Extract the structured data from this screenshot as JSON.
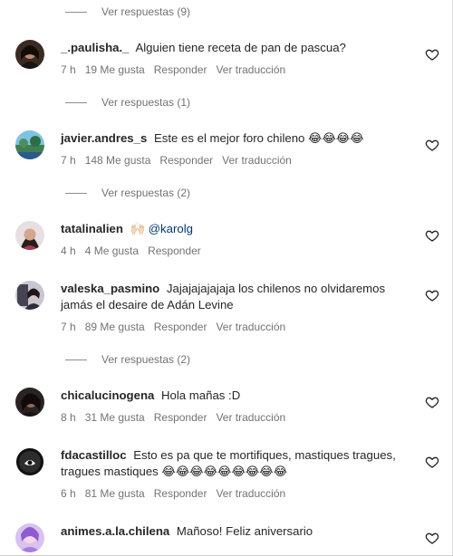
{
  "replies_label": {
    "r1": "Ver respuestas (9)",
    "r2": "Ver respuestas (1)",
    "r3": "Ver respuestas (2)",
    "r4": "Ver respuestas (2)"
  },
  "comments": [
    {
      "username": "_.paulisha._",
      "text": "Alguien tiene receta de pan de pascua?",
      "time": "7 h",
      "likes": "19 Me gusta",
      "reply": "Responder",
      "translate": "Ver traducción"
    },
    {
      "username": "javier.andres_s",
      "text": "Este es el mejor foro chileno 😂😂😂😂",
      "time": "7 h",
      "likes": "148 Me gusta",
      "reply": "Responder",
      "translate": "Ver traducción"
    },
    {
      "username": "tatalinalien",
      "text": "🙌🏻",
      "mention": "@karolg",
      "time": "4 h",
      "likes": "4 Me gusta",
      "reply": "Responder"
    },
    {
      "username": "valeska_pasmino",
      "text": "Jajajajajajaja los chilenos no olvidaremos jamás el desaire de Adán Levine",
      "time": "7 h",
      "likes": "89 Me gusta",
      "reply": "Responder",
      "translate": "Ver traducción"
    },
    {
      "username": "chicalucinogena",
      "text": "Hola mañas :D",
      "time": "8 h",
      "likes": "31 Me gusta",
      "reply": "Responder",
      "translate": "Ver traducción"
    },
    {
      "username": "fdacastilloc",
      "text": "Esto es pa que te mortifiques, mastiques tragues, tragues mastiques 😂😂😂😂😂😂😂😂😂",
      "time": "6 h",
      "likes": "81 Me gusta",
      "reply": "Responder",
      "translate": "Ver traducción"
    },
    {
      "username": "animes.a.la.chilena",
      "text": "Mañoso! Feliz aniversario"
    }
  ],
  "colors": {
    "text": "#262626",
    "meta": "#737373",
    "mention": "#00376b"
  },
  "icons": {
    "like": "heart-outline-icon"
  }
}
